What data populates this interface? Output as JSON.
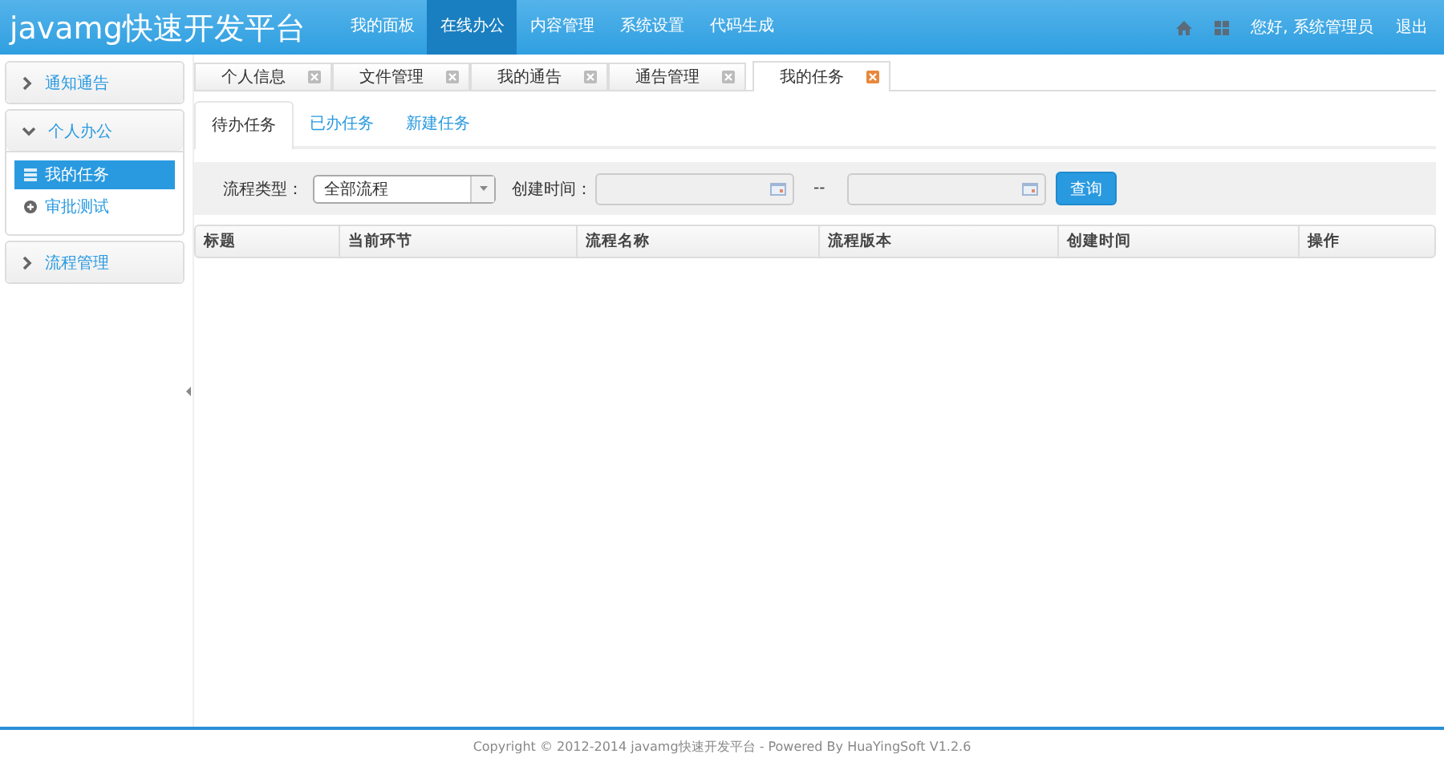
{
  "header": {
    "logo": "javamg快速开发平台",
    "nav": [
      {
        "label": "我的面板",
        "selected": false
      },
      {
        "label": "在线办公",
        "selected": true
      },
      {
        "label": "内容管理",
        "selected": false
      },
      {
        "label": "系统设置",
        "selected": false
      },
      {
        "label": "代码生成",
        "selected": false
      }
    ],
    "greeting": "您好, 系统管理员",
    "logout": "退出"
  },
  "sidebar": {
    "groups": [
      {
        "label": "通知通告",
        "expanded": false
      },
      {
        "label": "个人办公",
        "expanded": true,
        "items": [
          {
            "label": "我的任务",
            "kind": "list",
            "selected": true
          },
          {
            "label": "审批测试",
            "kind": "circle",
            "selected": false
          }
        ]
      },
      {
        "label": "流程管理",
        "expanded": false
      }
    ]
  },
  "tabs": [
    {
      "label": "个人信息",
      "selected": false
    },
    {
      "label": "文件管理",
      "selected": false
    },
    {
      "label": "我的通告",
      "selected": false
    },
    {
      "label": "通告管理",
      "selected": false
    },
    {
      "label": "我的任务",
      "selected": true
    }
  ],
  "subtabs": [
    {
      "label": "待办任务",
      "selected": true
    },
    {
      "label": "已办任务",
      "selected": false
    },
    {
      "label": "新建任务",
      "selected": false
    }
  ],
  "filter": {
    "type_label": "流程类型：",
    "type_value": "全部流程",
    "time_label": "创建时间：",
    "separator": "--",
    "search_button": "查询"
  },
  "table": {
    "columns": [
      "标题",
      "当前环节",
      "流程名称",
      "流程版本",
      "创建时间",
      "操作"
    ]
  },
  "footer": "Copyright © 2012-2014 javamg快速开发平台 - Powered By HuaYingSoft V1.2.6"
}
